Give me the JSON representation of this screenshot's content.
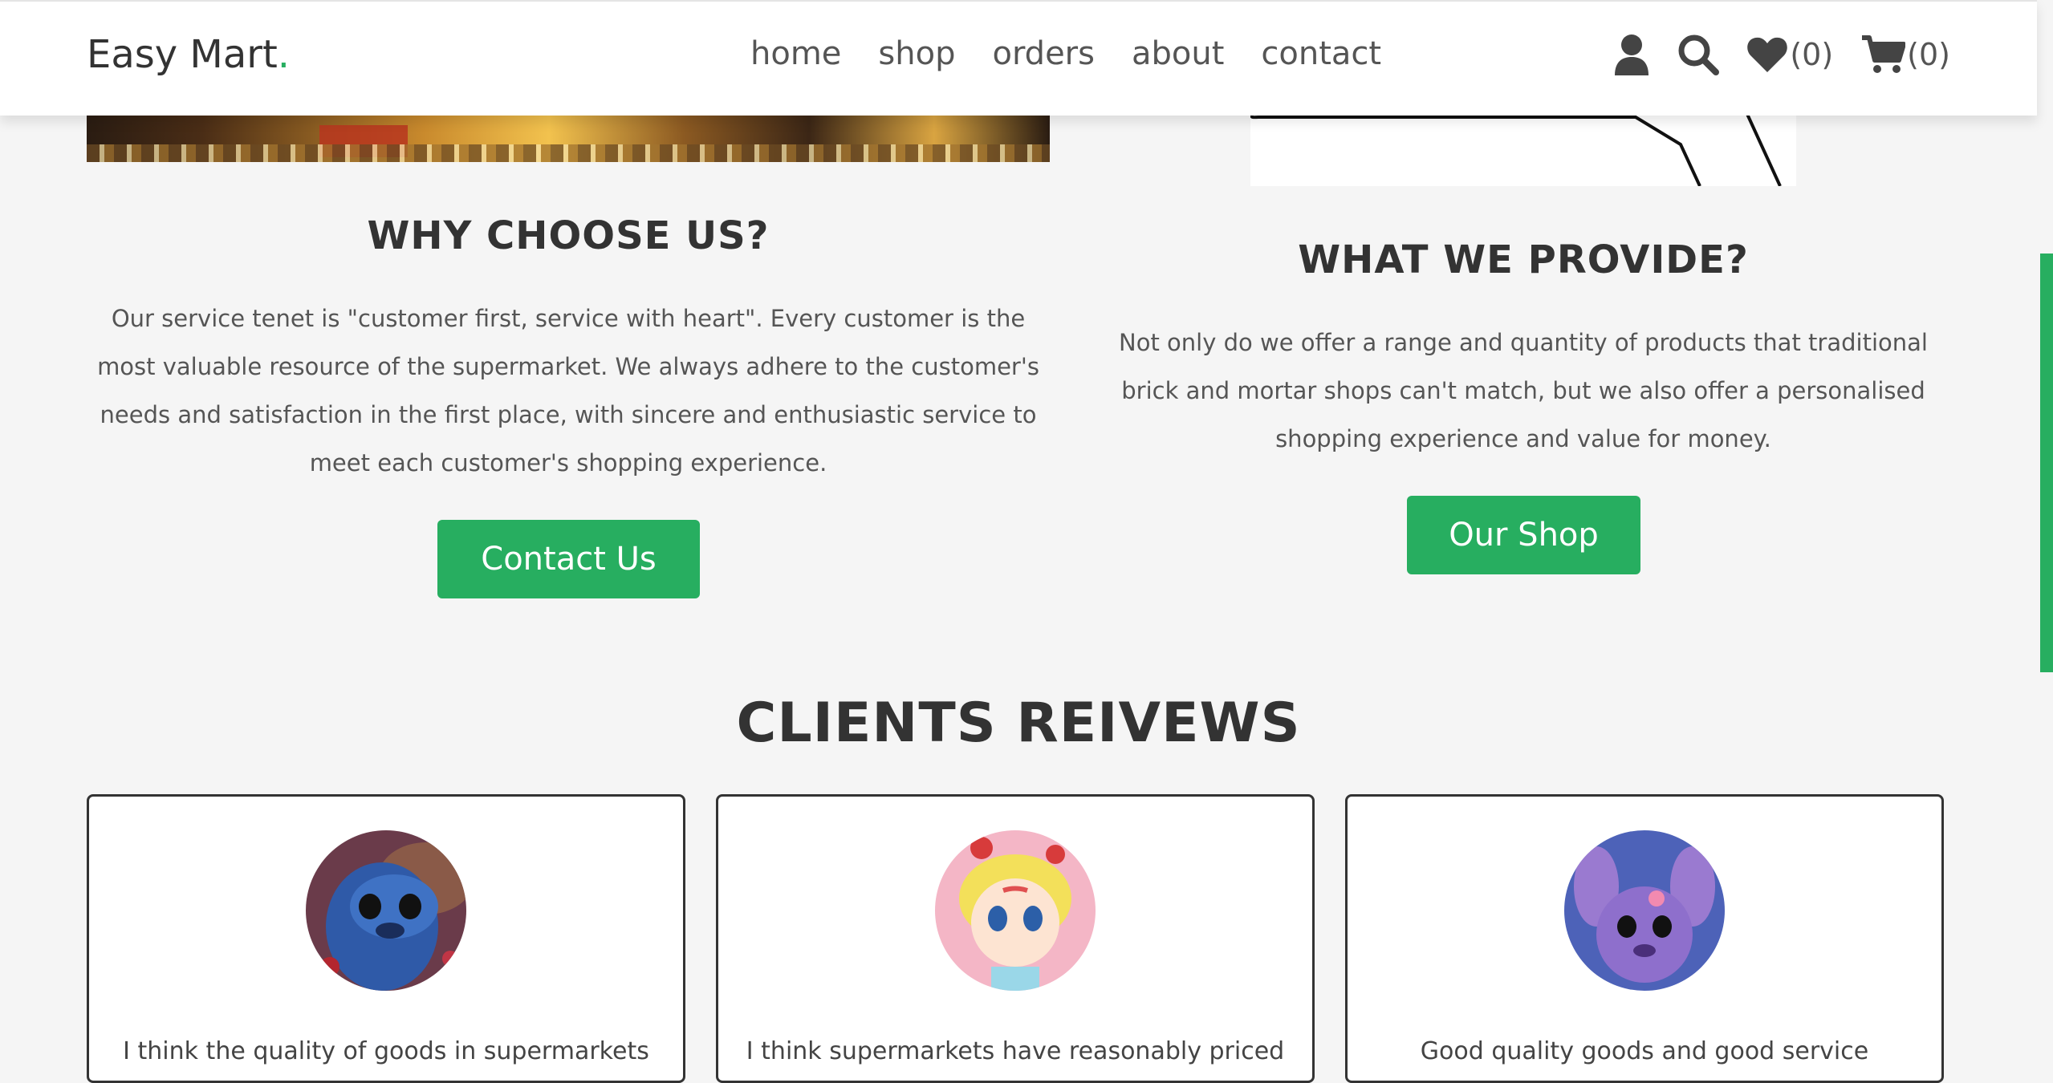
{
  "header": {
    "logo_text": "Easy Mart",
    "logo_dot": ".",
    "nav": [
      "home",
      "shop",
      "orders",
      "about",
      "contact"
    ],
    "wishlist_count": "(0)",
    "cart_count": "(0)",
    "icons": [
      "user-icon",
      "search-icon",
      "heart-icon",
      "cart-icon"
    ]
  },
  "why": {
    "title": "WHY CHOOSE US?",
    "text": "Our service tenet is \"customer first, service with heart\". Every customer is the most valuable resource of the supermarket. We always adhere to the customer's needs and satisfaction in the first place, with sincere and enthusiastic service to meet each customer's shopping experience.",
    "button": "Contact Us"
  },
  "provide": {
    "title": "WHAT WE PROVIDE?",
    "text": "Not only do we offer a range and quantity of products that traditional brick and mortar shops can't match, but we also offer a personalised shopping experience and value for money.",
    "button": "Our Shop"
  },
  "reviews": {
    "title": "CLIENTS REIVEWS",
    "items": [
      {
        "text": "I think the quality of goods in supermarkets"
      },
      {
        "text": "I think supermarkets have reasonably priced"
      },
      {
        "text": "Good quality goods and good service"
      }
    ]
  },
  "colors": {
    "accent": "#27ae60",
    "text": "#333333",
    "background": "#f5f5f5"
  }
}
